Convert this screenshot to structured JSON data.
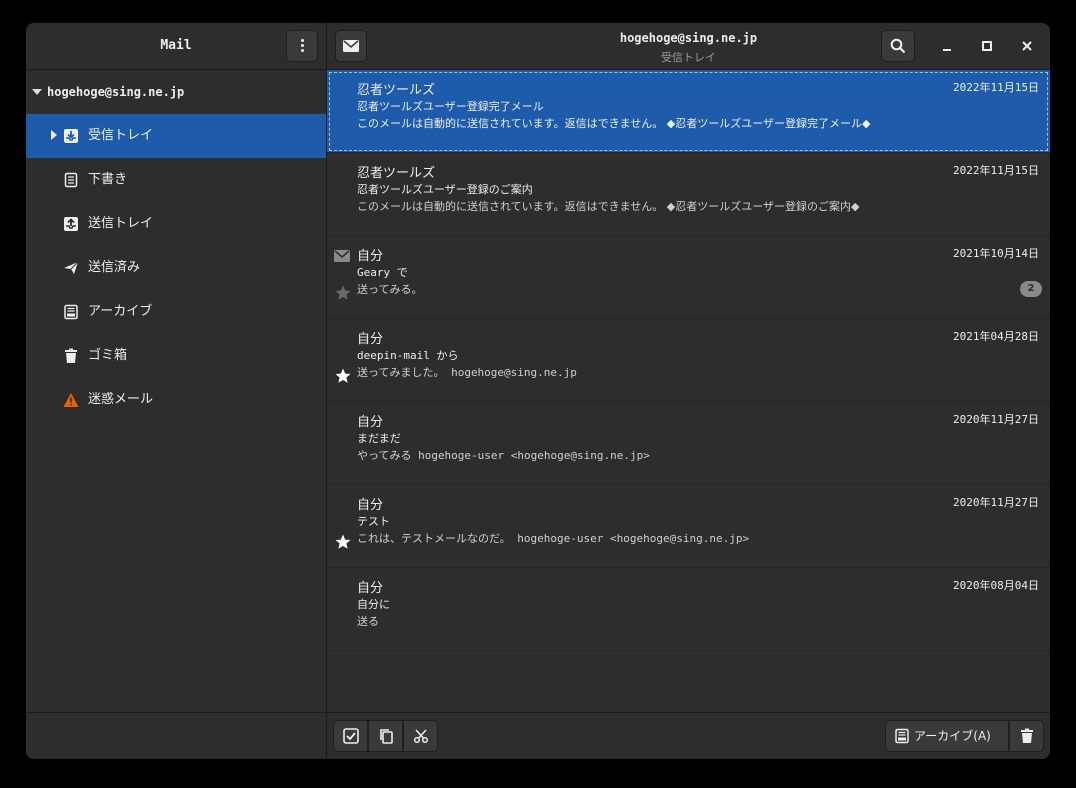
{
  "sidebar": {
    "title": "Mail",
    "account": "hogehoge@sing.ne.jp",
    "folders": [
      {
        "label": "受信トレイ",
        "icon": "inbox-icon"
      },
      {
        "label": "下書き",
        "icon": "drafts-icon"
      },
      {
        "label": "送信トレイ",
        "icon": "outbox-icon"
      },
      {
        "label": "送信済み",
        "icon": "sent-icon"
      },
      {
        "label": "アーカイブ",
        "icon": "archive-icon"
      },
      {
        "label": "ゴミ箱",
        "icon": "trash-icon"
      },
      {
        "label": "迷惑メール",
        "icon": "warning-icon"
      }
    ]
  },
  "header": {
    "title": "hogehoge@sing.ne.jp",
    "subtitle": "受信トレイ"
  },
  "messages": [
    {
      "from": "忍者ツールズ",
      "date": "2022年11月15日",
      "subject": "忍者ツールズユーザー登録完了メール",
      "preview": "このメールは自動的に送信されています。返信はできません。 ◆忍者ツールズユーザー登録完了メール◆"
    },
    {
      "from": "忍者ツールズ",
      "date": "2022年11月15日",
      "subject": "忍者ツールズユーザー登録のご案内",
      "preview": "このメールは自動的に送信されています。返信はできません。 ◆忍者ツールズユーザー登録のご案内◆"
    },
    {
      "from": "自分",
      "date": "2021年10月14日",
      "subject": "Geary で",
      "preview": "送ってみる。",
      "count": "2"
    },
    {
      "from": "自分",
      "date": "2021年04月28日",
      "subject": "deepin-mail から",
      "preview": "送ってみました。 hogehoge@sing.ne.jp"
    },
    {
      "from": "自分",
      "date": "2020年11月27日",
      "subject": "まだまだ",
      "preview": "やってみる hogehoge-user <hogehoge@sing.ne.jp>"
    },
    {
      "from": "自分",
      "date": "2020年11月27日",
      "subject": "テスト",
      "preview": "これは、テストメールなのだ。 hogehoge-user <hogehoge@sing.ne.jp>"
    },
    {
      "from": "自分",
      "date": "2020年08月04日",
      "subject": "自分に",
      "preview": "送る"
    }
  ],
  "footer": {
    "archive_label": "アーカイブ(A)"
  },
  "colors": {
    "accent": "#1f5bab",
    "window_bg": "#2d2d2d",
    "warning": "#e66100"
  }
}
